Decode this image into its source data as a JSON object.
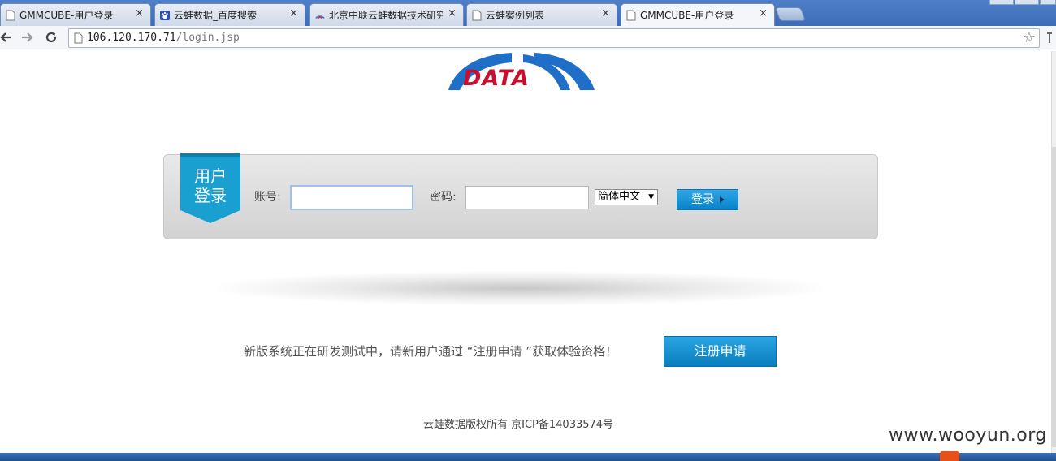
{
  "browser": {
    "tabs": [
      {
        "title": "GMMCUBE-用户登录",
        "icon": "page-icon",
        "active": false
      },
      {
        "title": "云蛙数据_百度搜索",
        "icon": "baidu-paw-icon",
        "active": false
      },
      {
        "title": "北京中联云蛙数据技术研究",
        "icon": "wifi-logo-icon",
        "active": false
      },
      {
        "title": "云蛙案例列表",
        "icon": "page-icon",
        "active": false
      },
      {
        "title": "GMMCUBE-用户登录",
        "icon": "page-icon",
        "active": true
      }
    ],
    "close_glyph": "×",
    "url_host": "106.120.170.71",
    "url_path": "/login.jsp"
  },
  "page": {
    "logo_text": "DATA",
    "login": {
      "ribbon_line1": "用户",
      "ribbon_line2": "登录",
      "account_label": "账号:",
      "account_value": "",
      "password_label": "密码:",
      "password_value": "",
      "language_selected": "简体中文",
      "login_button": "登录"
    },
    "notice": "新版系统正在研发测试中，请新用户通过 “注册申请 ”获取体验资格！",
    "register_button": "注册申请",
    "footer": "云蛙数据版权所有 京ICP备14033574号",
    "watermark": "www.wooyun.org"
  },
  "colors": {
    "accent_blue": "#0a82c8",
    "ribbon": "#1aa0d0",
    "logo_red": "#c8102e",
    "logo_blue": "#1f6fc8"
  }
}
